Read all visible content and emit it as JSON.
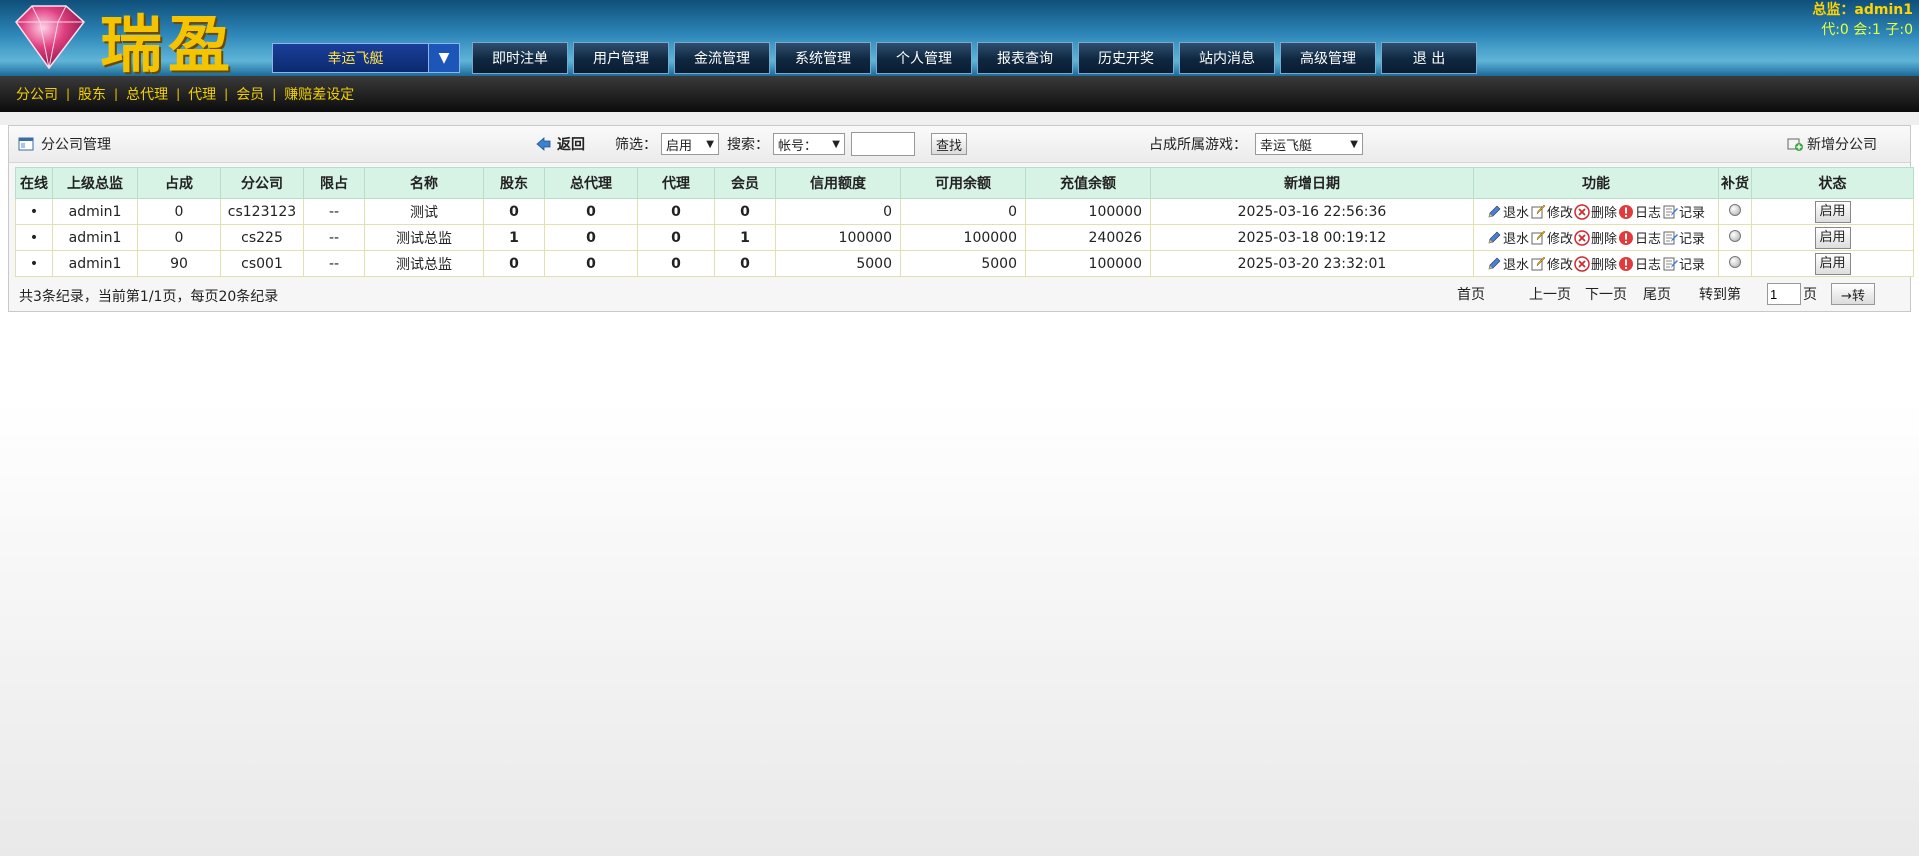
{
  "header": {
    "logo_text": "瑞盈",
    "game_selector": "幸运飞艇",
    "nav": [
      "即时注单",
      "用户管理",
      "金流管理",
      "系统管理",
      "个人管理",
      "报表查询",
      "历史开奖",
      "站内消息",
      "高级管理",
      "退 出"
    ],
    "user_line": "总监：admin1",
    "counts_line": "代:0 会:1 子:0"
  },
  "subnav": [
    "分公司",
    "股东",
    "总代理",
    "代理",
    "会员",
    "赚赔差设定"
  ],
  "toolbar": {
    "title": "分公司管理",
    "back": "返回",
    "filter_label": "筛选：",
    "filter_value": "启用",
    "search_label": "搜索：",
    "search_field": "帐号：",
    "search_input": "",
    "search_button": "查找",
    "game_label": "占成所属游戏：",
    "game_value": "幸运飞艇",
    "add_label": "新增分公司"
  },
  "table": {
    "headers": [
      "在线",
      "上级总监",
      "占成",
      "分公司",
      "限占",
      "名称",
      "股东",
      "总代理",
      "代理",
      "会员",
      "信用额度",
      "可用余额",
      "充值余额",
      "新增日期",
      "功能",
      "补货",
      "状态"
    ],
    "rows": [
      {
        "online": "•",
        "parent": "admin1",
        "share": "0",
        "company": "cs123123",
        "limit": "--",
        "name": "测试",
        "shareholders": "0",
        "general_agents": "0",
        "agents": "0",
        "members": "0",
        "credit": "0",
        "available": "0",
        "recharge": "100000",
        "date": "2025-03-16 22:56:36",
        "status": "启用"
      },
      {
        "online": "•",
        "parent": "admin1",
        "share": "0",
        "company": "cs225",
        "limit": "--",
        "name": "测试总监",
        "shareholders": "1",
        "general_agents": "0",
        "agents": "0",
        "members": "1",
        "credit": "100000",
        "available": "100000",
        "recharge": "240026",
        "date": "2025-03-18 00:19:12",
        "status": "启用"
      },
      {
        "online": "•",
        "parent": "admin1",
        "share": "90",
        "company": "cs001",
        "limit": "--",
        "name": "测试总监",
        "shareholders": "0",
        "general_agents": "0",
        "agents": "0",
        "members": "0",
        "credit": "5000",
        "available": "5000",
        "recharge": "100000",
        "date": "2025-03-20 23:32:01",
        "status": "启用"
      }
    ],
    "actions": [
      "退水",
      "修改",
      "删除",
      "日志",
      "记录"
    ]
  },
  "footer": {
    "summary": "共3条纪录，当前第1/1页，每页20条纪录",
    "first": "首页",
    "prev": "上一页",
    "next": "下一页",
    "last": "尾页",
    "goto_label": "转到第",
    "page_value": "1",
    "page_unit": "页",
    "go_button": "→转"
  },
  "colors": {
    "header_blue": "#2d86b8",
    "subnav_text": "#f2d000",
    "table_header": "#d7f3e6",
    "logo_gold": "#f5c400"
  }
}
